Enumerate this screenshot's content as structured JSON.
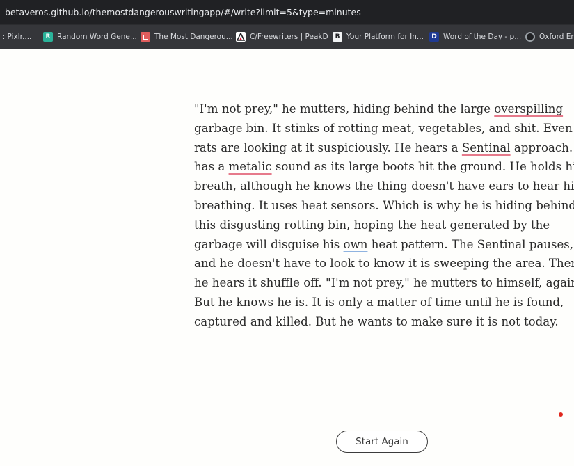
{
  "browser": {
    "url": "betaveros.github.io/themostdangerouswritingapp/#/write?limit=5&type=minutes",
    "bookmarks": [
      {
        "label": "r : Pixlr....",
        "icon": "none"
      },
      {
        "label": "Random Word Gene...",
        "icon": "r-logo-icon"
      },
      {
        "label": "The Most Dangerou...",
        "icon": "red-square-icon"
      },
      {
        "label": "C/Freewriters | PeakD",
        "icon": "peakd-icon"
      },
      {
        "label": "Your Platform for In...",
        "icon": "b-logo-icon"
      },
      {
        "label": "Word of the Day - p...",
        "icon": "d-logo-icon"
      },
      {
        "label": "Oxford Eng",
        "icon": "o-logo-icon"
      }
    ]
  },
  "editor": {
    "lines": [
      [
        {
          "t": "\"I'm not prey,\" he mutters, hiding behind the large "
        },
        {
          "t": "overspilling",
          "mark": "red"
        }
      ],
      [
        {
          "t": "garbage bin. It stinks of rotting meat, vegetables, and shit. Even the"
        }
      ],
      [
        {
          "t": "rats are looking at it suspiciously. He hears a "
        },
        {
          "t": "Sentinal",
          "mark": "red"
        },
        {
          "t": " approach. It"
        }
      ],
      [
        {
          "t": "has a "
        },
        {
          "t": "metalic",
          "mark": "red"
        },
        {
          "t": " sound as its large boots hit the ground. He holds his"
        }
      ],
      [
        {
          "t": "breath, although he knows the thing doesn't have ears to hear him"
        }
      ],
      [
        {
          "t": "breathing. It uses heat sensors. Which is why he is hiding behind"
        }
      ],
      [
        {
          "t": "this disgusting rotting bin, hoping the heat generated by the"
        }
      ],
      [
        {
          "t": "garbage will disguise his "
        },
        {
          "t": "own",
          "mark": "blue"
        },
        {
          "t": " heat pattern. The Sentinal pauses,"
        }
      ],
      [
        {
          "t": "and he doesn't have to look to know it is sweeping the area. Then"
        }
      ],
      [
        {
          "t": "he hears it shuffle off. \"I'm not prey,\" he mutters to himself, again."
        }
      ],
      [
        {
          "t": "But he knows he is. It is only a matter of time until he is found,"
        }
      ],
      [
        {
          "t": "captured and killed. But he wants to make sure it is not today."
        }
      ]
    ]
  },
  "actions": {
    "start_again_label": "Start Again"
  },
  "colors": {
    "page_background": "#fefefc",
    "danger_dot": "#e0281e",
    "spell_error": "#e67a8b",
    "grammar_hint": "#8fb3e0"
  }
}
